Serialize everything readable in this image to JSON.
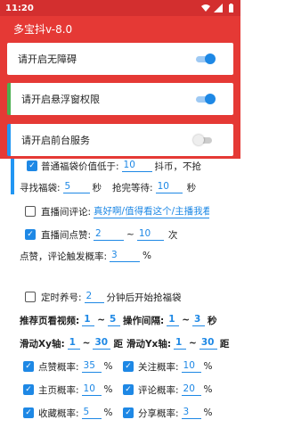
{
  "status": {
    "time": "11:20"
  },
  "app": {
    "title": "多宝抖v-8.0"
  },
  "cards": [
    {
      "label": "请开启无障碍",
      "on": true
    },
    {
      "label": "请开启悬浮窗权限",
      "on": true
    },
    {
      "label": "请开启前台服务",
      "on": false
    }
  ],
  "settings": {
    "fubag_label": "普通福袋价值低于:",
    "fubag_value": "10",
    "fubag_suffix": "抖币，不抢",
    "find_label": "寻找福袋:",
    "find_value": "5",
    "find_unit": "秒",
    "wait_label": "抢完等待:",
    "wait_value": "10",
    "wait_unit": "秒",
    "comment_label": "直播间评论:",
    "comment_value": "真好啊/值得看这个/主播我看好",
    "like_label": "直播间点赞:",
    "like_min": "2",
    "like_sep": "~",
    "like_max": "10",
    "like_unit": "次",
    "like_prob_label": "点赞，评论触发概率:",
    "like_prob_value": "3",
    "like_prob_unit": "%",
    "timer_label": "定时养号:",
    "timer_value": "2",
    "timer_suffix": "分钟后开始抢福袋",
    "rec_label": "推荐页看视频:",
    "rec_min": "1",
    "rec_sep": "~",
    "rec_max": "5",
    "op_label": "操作间隔:",
    "op_min": "1",
    "op_sep": "~",
    "op_max": "3",
    "op_unit": "秒",
    "swx_label": "滑动Xy轴:",
    "swx_min": "1",
    "swx_sep": "~",
    "swx_max": "30",
    "swx_unit": "距",
    "swy_label": "滑动Yx轴:",
    "swy_min": "1",
    "swy_sep": "~",
    "swy_max": "30",
    "swy_unit": "距",
    "prob": [
      {
        "label": "点赞概率:",
        "value": "35",
        "unit": "%"
      },
      {
        "label": "关注概率:",
        "value": "10",
        "unit": "%"
      },
      {
        "label": "主页概率:",
        "value": "10",
        "unit": "%"
      },
      {
        "label": "评论概率:",
        "value": "20",
        "unit": "%"
      },
      {
        "label": "收藏概率:",
        "value": "5",
        "unit": "%"
      },
      {
        "label": "分享概率:",
        "value": "3",
        "unit": "%"
      }
    ]
  }
}
